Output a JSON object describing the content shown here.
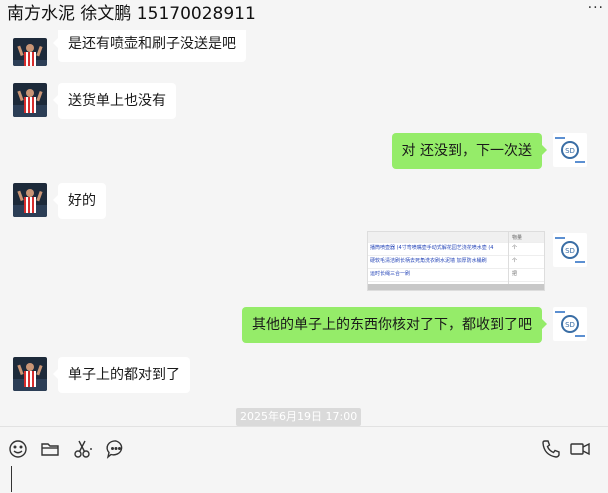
{
  "header": {
    "title": "南方水泥 徐文鹏 15170028911"
  },
  "messages": [
    {
      "side": "in",
      "text": "是还有喷壶和刷子没送是吧"
    },
    {
      "side": "in",
      "text": "送货单上也没有"
    },
    {
      "side": "out",
      "text": "对 还没到，下一次送"
    },
    {
      "side": "in",
      "text": "好的"
    },
    {
      "side": "out",
      "type": "image",
      "rows": [
        "播筒喷壶器 (4寸弯喷嘴壶手动式解花园艺浇花喷水壶 (4",
        "硬软毛清洁刷长柄去死角洗衣刷水泥墙 加厚防水桶刷",
        "运时长绳三合一刷"
      ],
      "status_header": "物量",
      "status_values": [
        "个",
        "个",
        "把"
      ]
    },
    {
      "side": "out",
      "text": "其他的单子上的东西你核对了下，都收到了吧"
    },
    {
      "side": "in",
      "text": "单子上的都对到了"
    }
  ],
  "timestamp": "2025年6月19日 17:00",
  "toolbar": {
    "left_icons": [
      "emoji-icon",
      "folder-icon",
      "scissors-icon",
      "chat-bubble-icon"
    ],
    "right_icons": [
      "phone-icon",
      "video-icon"
    ]
  },
  "input": {
    "value": ""
  }
}
